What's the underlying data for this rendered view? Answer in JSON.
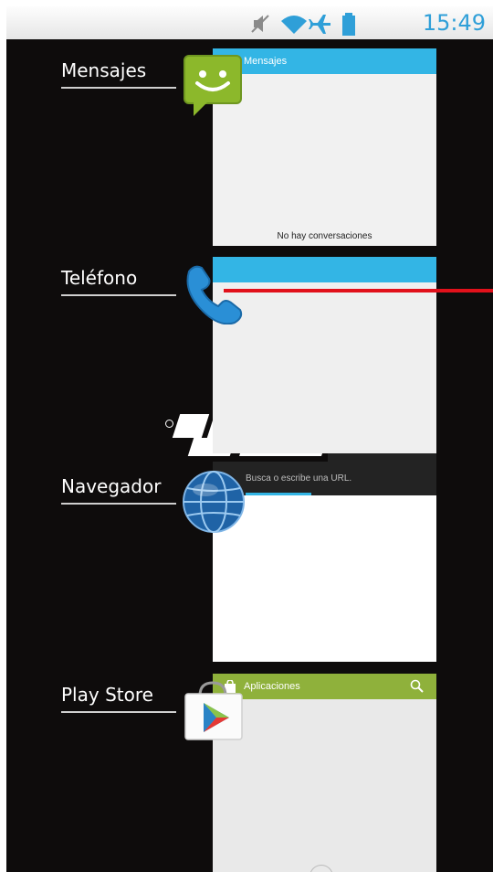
{
  "status_bar": {
    "time": "15:49",
    "icons": [
      "muted-icon",
      "wifi-icon",
      "airplane-icon",
      "battery-icon"
    ],
    "accent": "#2f9fd8"
  },
  "recent_apps": [
    {
      "label": "Mensajes",
      "thumb_title": "Mensajes",
      "thumb_text": "No hay conversaciones",
      "icon": "messages-icon"
    },
    {
      "label": "Teléfono",
      "icon": "phone-icon"
    },
    {
      "label": "Navegador",
      "url_placeholder": "Busca o escribe una URL.",
      "icon": "browser-globe-icon"
    },
    {
      "label": "Play Store",
      "thumb_title": "Aplicaciones",
      "icon": "play-store-icon"
    }
  ],
  "colors": {
    "bar_blue": "#33b5e5",
    "play_green": "#8fb13b",
    "background": "#0e0c0c"
  }
}
